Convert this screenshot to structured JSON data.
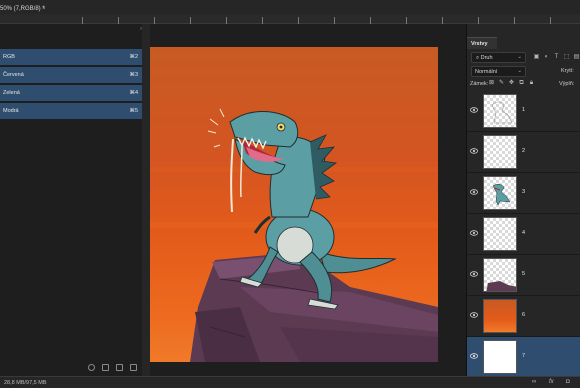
{
  "document": {
    "tab_title": "50% (7,RGB/8) *",
    "close_symbol": "×"
  },
  "channels": {
    "rows": [
      {
        "label": "RGB",
        "shortcut": "⌘2"
      },
      {
        "label": "Červená",
        "shortcut": "⌘3"
      },
      {
        "label": "Zelená",
        "shortcut": "⌘4"
      },
      {
        "label": "Modrá",
        "shortcut": "⌘5"
      }
    ],
    "collapse_marks": "»"
  },
  "layers_panel": {
    "tab_label": "Vrstvy",
    "kind_filter": "⌕ Druh",
    "kind_arrow": "⌄",
    "blend_mode": "Normální",
    "blend_arrow": "⌄",
    "opacity_label": "Krytí:",
    "lock_label": "Zámek:",
    "fill_label": "Výplň:",
    "layers": [
      {
        "name": "1",
        "thumb": "sketch"
      },
      {
        "name": "2",
        "thumb": "transparent"
      },
      {
        "name": "3",
        "thumb": "dino"
      },
      {
        "name": "4",
        "thumb": "transparent"
      },
      {
        "name": "5",
        "thumb": "rocks"
      },
      {
        "name": "6",
        "thumb": "gradient"
      },
      {
        "name": "7",
        "thumb": "white"
      }
    ]
  },
  "status": {
    "text": "28,8 MB/97,5 MB",
    "fx_label": "fx"
  },
  "colors": {
    "selection": "#2f4d6e",
    "panel_bg": "#262626",
    "app_bg": "#1e1e1e"
  }
}
